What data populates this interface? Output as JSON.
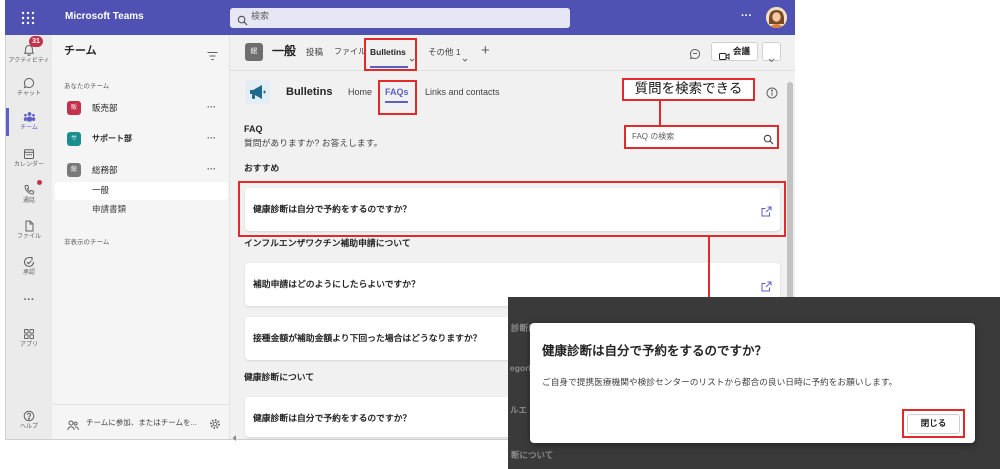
{
  "app": {
    "title": "Microsoft Teams",
    "search_placeholder": "検索",
    "more_label": "···"
  },
  "rail": {
    "items": [
      {
        "label": "アクティビティ",
        "icon": "bell-icon",
        "badge": "31"
      },
      {
        "label": "チャット",
        "icon": "chat-icon"
      },
      {
        "label": "チーム",
        "icon": "teams-icon",
        "active": true
      },
      {
        "label": "カレンダー",
        "icon": "calendar-icon"
      },
      {
        "label": "通話",
        "icon": "phone-icon"
      },
      {
        "label": "ファイル",
        "icon": "file-icon"
      },
      {
        "label": "承認",
        "icon": "approvals-icon"
      },
      {
        "label": "アプリ",
        "icon": "apps-icon"
      },
      {
        "label": "ヘルプ",
        "icon": "help-icon"
      }
    ],
    "more_label": "···"
  },
  "sidebar": {
    "title": "チーム",
    "your_teams_label": "あなたのチーム",
    "more_label": "···",
    "teams": [
      {
        "name": "販売部",
        "avatar": "販",
        "color": "#c4314b"
      },
      {
        "name": "サポート部",
        "avatar": "サ",
        "color": "#1b8f8f"
      },
      {
        "name": "総務部",
        "avatar": "総",
        "color": "#7a7a7a",
        "channels": [
          {
            "name": "一般",
            "selected": true
          },
          {
            "name": "申請書類"
          }
        ]
      }
    ],
    "hidden_teams_label": "非表示のチーム",
    "join_label": "チームに参加、またはチームを..."
  },
  "channel": {
    "avatar": "総",
    "name": "一般",
    "tabs": [
      {
        "label": "投稿"
      },
      {
        "label": "ファイル"
      },
      {
        "label": "Bulletins",
        "active": true
      },
      {
        "label": "その他 1"
      }
    ],
    "add_label": "+",
    "meet_label": "会議"
  },
  "bulletins": {
    "app_name": "Bulletins",
    "nav": [
      {
        "label": "Home"
      },
      {
        "label": "FAQs",
        "active": true
      },
      {
        "label": "Links and contacts"
      }
    ],
    "faq_title": "FAQ",
    "faq_subtitle": "質問がありますか? お答えします。",
    "search_placeholder": "FAQ の検索",
    "sections": [
      {
        "title": "おすすめ",
        "items": [
          {
            "question": "健康診断は自分で予約をするのですか？"
          }
        ]
      },
      {
        "title": "インフルエンザワクチン補助申請について",
        "items": [
          {
            "question": "補助申請はどのようにしたらよいですか？"
          },
          {
            "question": "接種金額が補助金額より下回った場合はどうなりますか？"
          }
        ]
      },
      {
        "title": "健康診断について",
        "items": [
          {
            "question": "健康診断は自分で予約をするのですか？"
          }
        ]
      }
    ]
  },
  "annotation": {
    "callout": "質問を検索できる"
  },
  "dialog": {
    "title": "健康診断は自分で予約をするのですか？",
    "body": "ご自身で提携医療機関や検診センターのリストから都合の良い日時に予約をお願いします。",
    "close_label": "閉じる",
    "background_fragments": [
      "診断に",
      "egori",
      "ルエ",
      "断について"
    ]
  },
  "colors": {
    "topbar": "#4f52b2",
    "brand": "#5b5fc7",
    "annotation": "#e32a2a",
    "badge": "#c4314b",
    "overlay": "#3a3a3a"
  }
}
